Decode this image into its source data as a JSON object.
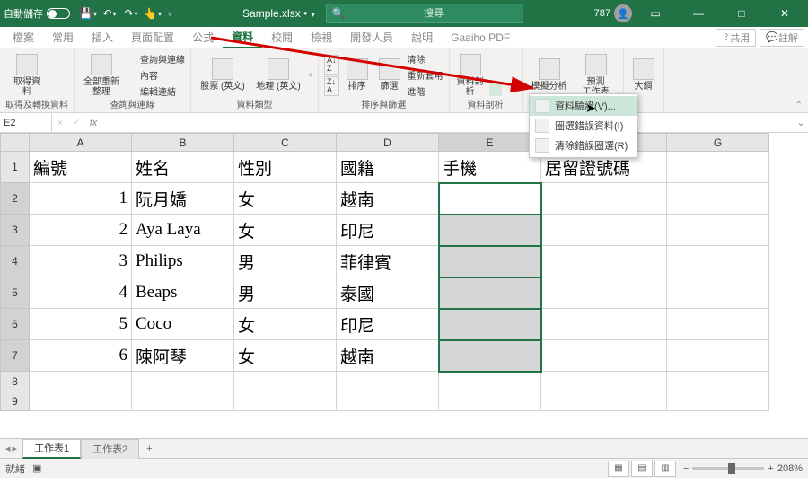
{
  "titlebar": {
    "autosave_label": "自動儲存",
    "autosave_state": "關閉",
    "filename": "Sample.xlsx",
    "saved_indicator": "•",
    "search_placeholder": "搜尋",
    "user_score": "787"
  },
  "tabs": {
    "items": [
      "檔案",
      "常用",
      "插入",
      "頁面配置",
      "公式",
      "資料",
      "校閱",
      "檢視",
      "開發人員",
      "說明",
      "Gaaiho PDF"
    ],
    "active_index": 5,
    "share": "共用",
    "comments": "註解"
  },
  "ribbon": {
    "groups": [
      {
        "label": "取得及轉換資料",
        "buttons": [
          {
            "label": "取得資\n料"
          }
        ]
      },
      {
        "label": "查詢與連線",
        "buttons": [
          {
            "label": "全部重新整理"
          }
        ],
        "links": [
          "查詢與連線",
          "內容",
          "編輯連結"
        ]
      },
      {
        "label": "資料類型",
        "buttons": [
          {
            "label": "股票 (英文)"
          },
          {
            "label": "地理 (英文)"
          }
        ]
      },
      {
        "label": "排序與篩選",
        "buttons": [
          {
            "label": "排序"
          },
          {
            "label": "篩選"
          }
        ],
        "links": [
          "清除",
          "重新套用",
          "進階"
        ],
        "az": "A\nZ",
        "za": "Z\nA"
      },
      {
        "label": "資料剖析",
        "buttons": [
          {
            "label": "資料剖析"
          }
        ]
      },
      {
        "label": "",
        "buttons": [
          {
            "label": "模擬分析"
          },
          {
            "label": "預測\n工作表"
          }
        ]
      },
      {
        "label": "",
        "buttons": [
          {
            "label": "大綱"
          }
        ]
      }
    ]
  },
  "formula_bar": {
    "name": "E2",
    "fx": "fx"
  },
  "dropdown": {
    "items": [
      {
        "icon": "validate",
        "label": "資料驗證(V)..."
      },
      {
        "icon": "circle",
        "label": "圈選錯誤資料(I)"
      },
      {
        "icon": "clear",
        "label": "清除錯誤圈選(R)"
      }
    ],
    "highlight": 0
  },
  "grid": {
    "columns": [
      "A",
      "B",
      "C",
      "D",
      "E",
      "F",
      "G"
    ],
    "headers": [
      "編號",
      "姓名",
      "性別",
      "國籍",
      "手機",
      "居留證號碼",
      ""
    ],
    "rows": [
      {
        "n": "1",
        "name": "阮月嬌",
        "sex": "女",
        "nat": "越南"
      },
      {
        "n": "2",
        "name": "Aya Laya",
        "sex": "女",
        "nat": "印尼"
      },
      {
        "n": "3",
        "name": "Philips",
        "sex": "男",
        "nat": "菲律賓"
      },
      {
        "n": "4",
        "name": "Beaps",
        "sex": "男",
        "nat": "泰國"
      },
      {
        "n": "5",
        "name": "Coco",
        "sex": "女",
        "nat": "印尼"
      },
      {
        "n": "6",
        "name": "陳阿琴",
        "sex": "女",
        "nat": "越南"
      }
    ],
    "selection": "E2:E7",
    "active": "E2"
  },
  "sheets": {
    "items": [
      "工作表1",
      "工作表2"
    ],
    "active": 0,
    "add": "+"
  },
  "status": {
    "mode": "就緒",
    "acc": "",
    "zoom": "208%"
  }
}
